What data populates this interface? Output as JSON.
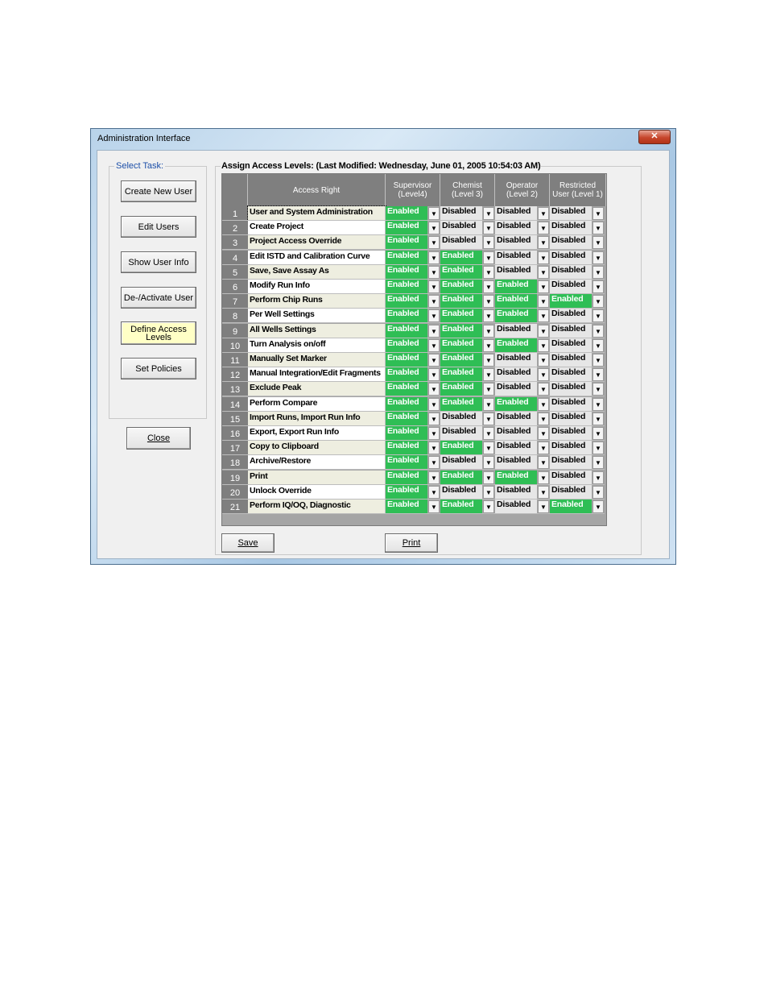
{
  "window": {
    "title": "Administration Interface",
    "close_glyph": "✕"
  },
  "task_panel": {
    "legend": "Select Task:",
    "buttons": [
      "Create New User",
      "Edit Users",
      "Show User Info",
      "De-/Activate User",
      "Define Access Levels",
      "Set Policies"
    ],
    "active_index": 4
  },
  "close_button": {
    "label": "Close"
  },
  "assign": {
    "legend": "Assign Access Levels: (Last Modified: Wednesday, June 01, 2005 10:54:03 AM)",
    "headers": [
      "",
      "Access Right",
      "Supervisor (Level4)",
      "Chemist (Level 3)",
      "Operator (Level 2)",
      "Restricted User (Level 1)"
    ],
    "rows": [
      {
        "n": "1",
        "name": "User and System Administration",
        "v": [
          "Enabled",
          "Disabled",
          "Disabled",
          "Disabled"
        ]
      },
      {
        "n": "2",
        "name": "Create Project",
        "v": [
          "Enabled",
          "Disabled",
          "Disabled",
          "Disabled"
        ]
      },
      {
        "n": "3",
        "name": "Project Access Override",
        "v": [
          "Enabled",
          "Disabled",
          "Disabled",
          "Disabled"
        ]
      },
      {
        "n": "4",
        "name": "Edit ISTD and Calibration Curve",
        "v": [
          "Enabled",
          "Enabled",
          "Disabled",
          "Disabled"
        ]
      },
      {
        "n": "5",
        "name": "Save, Save Assay As",
        "v": [
          "Enabled",
          "Enabled",
          "Disabled",
          "Disabled"
        ]
      },
      {
        "n": "6",
        "name": "Modify Run Info",
        "v": [
          "Enabled",
          "Enabled",
          "Enabled",
          "Disabled"
        ]
      },
      {
        "n": "7",
        "name": "Perform Chip Runs",
        "v": [
          "Enabled",
          "Enabled",
          "Enabled",
          "Enabled"
        ]
      },
      {
        "n": "8",
        "name": "Per Well Settings",
        "v": [
          "Enabled",
          "Enabled",
          "Enabled",
          "Disabled"
        ]
      },
      {
        "n": "9",
        "name": "All Wells Settings",
        "v": [
          "Enabled",
          "Enabled",
          "Disabled",
          "Disabled"
        ]
      },
      {
        "n": "10",
        "name": "Turn Analysis on/off",
        "v": [
          "Enabled",
          "Enabled",
          "Enabled",
          "Disabled"
        ]
      },
      {
        "n": "11",
        "name": "Manually Set Marker",
        "v": [
          "Enabled",
          "Enabled",
          "Disabled",
          "Disabled"
        ]
      },
      {
        "n": "12",
        "name": "Manual Integration/Edit Fragments",
        "v": [
          "Enabled",
          "Enabled",
          "Disabled",
          "Disabled"
        ]
      },
      {
        "n": "13",
        "name": "Exclude Peak",
        "v": [
          "Enabled",
          "Enabled",
          "Disabled",
          "Disabled"
        ]
      },
      {
        "n": "14",
        "name": "Perform Compare",
        "v": [
          "Enabled",
          "Enabled",
          "Enabled",
          "Disabled"
        ]
      },
      {
        "n": "15",
        "name": "Import Runs, Import Run Info",
        "v": [
          "Enabled",
          "Disabled",
          "Disabled",
          "Disabled"
        ]
      },
      {
        "n": "16",
        "name": "Export, Export Run Info",
        "v": [
          "Enabled",
          "Disabled",
          "Disabled",
          "Disabled"
        ]
      },
      {
        "n": "17",
        "name": "Copy to Clipboard",
        "v": [
          "Enabled",
          "Enabled",
          "Disabled",
          "Disabled"
        ]
      },
      {
        "n": "18",
        "name": "Archive/Restore",
        "v": [
          "Enabled",
          "Disabled",
          "Disabled",
          "Disabled"
        ]
      },
      {
        "n": "19",
        "name": "Print",
        "v": [
          "Enabled",
          "Enabled",
          "Enabled",
          "Disabled"
        ]
      },
      {
        "n": "20",
        "name": "Unlock Override",
        "v": [
          "Enabled",
          "Disabled",
          "Disabled",
          "Disabled"
        ]
      },
      {
        "n": "21",
        "name": "Perform IQ/OQ, Diagnostic",
        "v": [
          "Enabled",
          "Enabled",
          "Disabled",
          "Enabled"
        ]
      }
    ]
  },
  "actions": {
    "save": "Save",
    "print": "Print"
  },
  "colors": {
    "enabled": "#2fbe55",
    "disabled": "#e6e6e6",
    "header": "#7f7f7f"
  },
  "icons": {
    "dropdown": "chevron-down-icon"
  }
}
